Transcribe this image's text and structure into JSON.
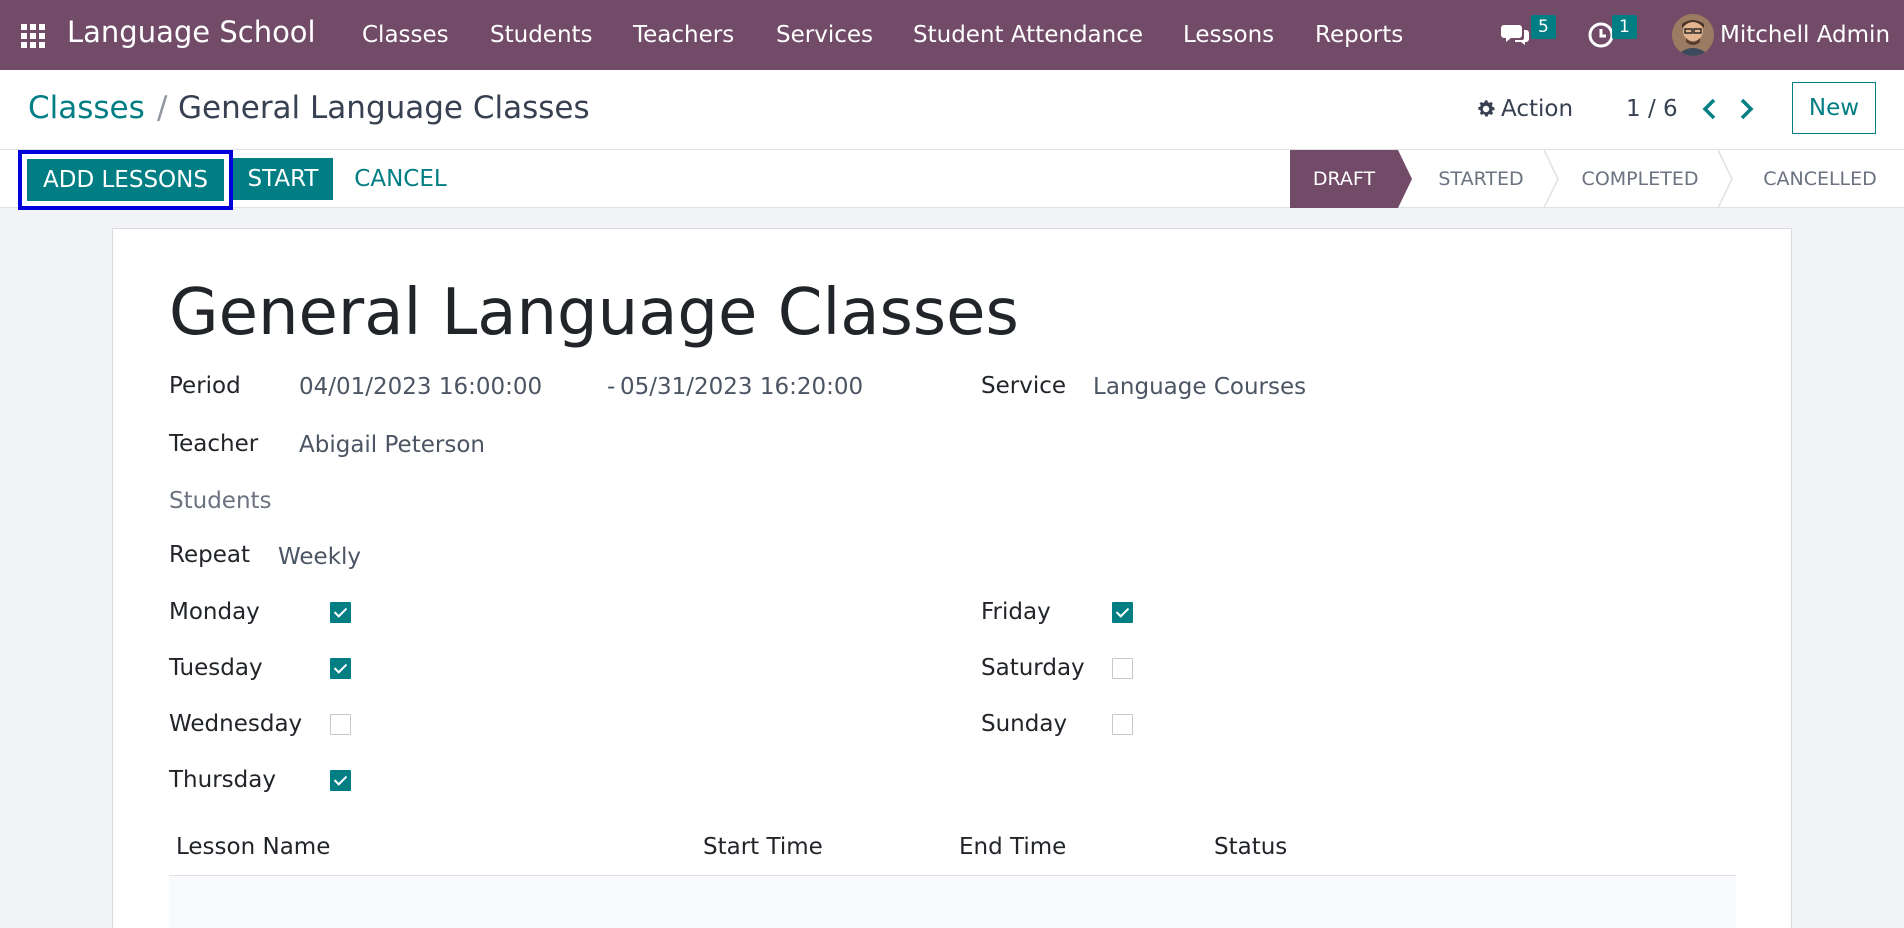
{
  "navbar": {
    "brand": "Language School",
    "menu": [
      "Classes",
      "Students",
      "Teachers",
      "Services",
      "Student Attendance",
      "Lessons",
      "Reports"
    ],
    "messages_count": "5",
    "activities_count": "1",
    "user_name": "Mitchell Admin"
  },
  "breadcrumb": {
    "parent": "Classes",
    "separator": "/",
    "current": "General Language Classes"
  },
  "control": {
    "action_label": "Action",
    "pager": "1 / 6",
    "new_label": "New"
  },
  "buttons": {
    "add_lessons": "ADD LESSONS",
    "start": "START",
    "cancel": "CANCEL"
  },
  "stages": [
    "DRAFT",
    "STARTED",
    "COMPLETED",
    "CANCELLED"
  ],
  "form": {
    "title": "General Language Classes",
    "period_label": "Period",
    "period_start": "04/01/2023 16:00:00",
    "period_sep": "-",
    "period_end": "05/31/2023 16:20:00",
    "service_label": "Service",
    "service_value": "Language Courses",
    "teacher_label": "Teacher",
    "teacher_value": "Abigail Peterson",
    "students_label": "Students",
    "repeat_label": "Repeat",
    "repeat_value": "Weekly",
    "days": {
      "monday": {
        "label": "Monday",
        "checked": true
      },
      "tuesday": {
        "label": "Tuesday",
        "checked": true
      },
      "wednesday": {
        "label": "Wednesday",
        "checked": false
      },
      "thursday": {
        "label": "Thursday",
        "checked": true
      },
      "friday": {
        "label": "Friday",
        "checked": true
      },
      "saturday": {
        "label": "Saturday",
        "checked": false
      },
      "sunday": {
        "label": "Sunday",
        "checked": false
      }
    }
  },
  "lessons_table": {
    "columns": [
      "Lesson Name",
      "Start Time",
      "End Time",
      "Status"
    ]
  },
  "colors": {
    "brand": "#714b67",
    "accent": "#017e84",
    "highlight": "#0000dd"
  }
}
